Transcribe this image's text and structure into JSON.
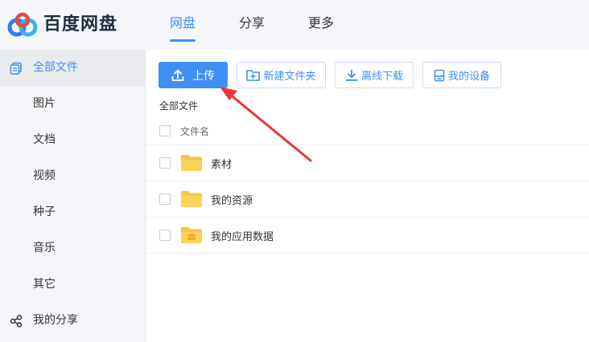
{
  "app": {
    "logo_text": "百度网盘"
  },
  "nav": {
    "tabs": [
      {
        "label": "网盘"
      },
      {
        "label": "分享"
      },
      {
        "label": "更多"
      }
    ]
  },
  "sidebar": {
    "items": [
      {
        "label": "全部文件"
      },
      {
        "label": "图片"
      },
      {
        "label": "文档"
      },
      {
        "label": "视频"
      },
      {
        "label": "种子"
      },
      {
        "label": "音乐"
      },
      {
        "label": "其它"
      },
      {
        "label": "我的分享"
      }
    ]
  },
  "toolbar": {
    "upload_label": "上传",
    "new_folder_label": "新建文件夹",
    "offline_download_label": "离线下载",
    "my_devices_label": "我的设备"
  },
  "breadcrumb": {
    "current": "全部文件"
  },
  "file_table": {
    "column_name": "文件名",
    "rows": [
      {
        "name": "素材"
      },
      {
        "name": "我的资源"
      },
      {
        "name": "我的应用数据"
      }
    ]
  },
  "colors": {
    "accent": "#3f8ef5",
    "folder": "#fcd35a",
    "arrow": "#e8373a"
  }
}
